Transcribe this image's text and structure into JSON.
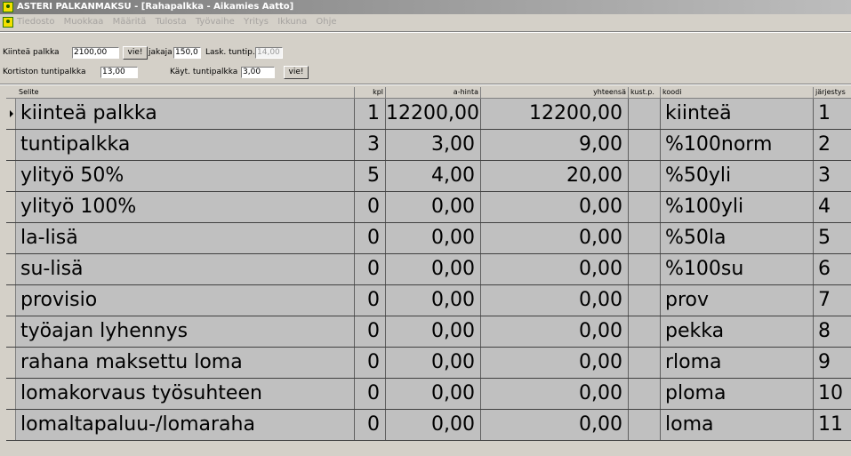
{
  "window": {
    "title": "ASTERI PALKANMAKSU - [Rahapalkka - Aikamies Aatto]"
  },
  "menu": [
    "Tiedosto",
    "Muokkaa",
    "Määritä",
    "Tulosta",
    "Työvaihe",
    "Yritys",
    "Ikkuna",
    "Ohje"
  ],
  "form": {
    "kiintea_label": "Kiinteä palkka",
    "kiintea_value": "2100,00",
    "vie1_label": "vie!",
    "jakaja_label": "jakaja",
    "jakaja_value": "150,0",
    "lask_label": "Lask. tuntip.",
    "lask_value": "14,00",
    "kortiston_label": "Kortiston tuntipalkka",
    "kortiston_value": "13,00",
    "kayt_label": "Käyt. tuntipalkka",
    "kayt_value": "3,00",
    "vie2_label": "vie!"
  },
  "grid": {
    "headers": [
      "Selite",
      "kpl",
      "a-hinta",
      "yhteensä",
      "kust.p.",
      "koodi",
      "järjestys"
    ],
    "rows": [
      [
        "kiinteä palkka",
        "1",
        "12200,00",
        "12200,00",
        "",
        "kiinteä",
        "1"
      ],
      [
        "tuntipalkka",
        "3",
        "3,00",
        "9,00",
        "",
        "%100norm",
        "2"
      ],
      [
        "ylityö 50%",
        "5",
        "4,00",
        "20,00",
        "",
        "%50yli",
        "3"
      ],
      [
        "ylityö 100%",
        "0",
        "0,00",
        "0,00",
        "",
        "%100yli",
        "4"
      ],
      [
        "la-lisä",
        "0",
        "0,00",
        "0,00",
        "",
        "%50la",
        "5"
      ],
      [
        "su-lisä",
        "0",
        "0,00",
        "0,00",
        "",
        "%100su",
        "6"
      ],
      [
        "provisio",
        "0",
        "0,00",
        "0,00",
        "",
        "prov",
        "7"
      ],
      [
        "työajan lyhennys",
        "0",
        "0,00",
        "0,00",
        "",
        "pekka",
        "8"
      ],
      [
        "rahana maksettu loma",
        "0",
        "0,00",
        "0,00",
        "",
        "rloma",
        "9"
      ],
      [
        "lomakorvaus työsuhteen",
        "0",
        "0,00",
        "0,00",
        "",
        "ploma",
        "10"
      ],
      [
        "lomaltapaluu-/lomaraha",
        "0",
        "0,00",
        "0,00",
        "",
        "loma",
        "11"
      ]
    ]
  }
}
